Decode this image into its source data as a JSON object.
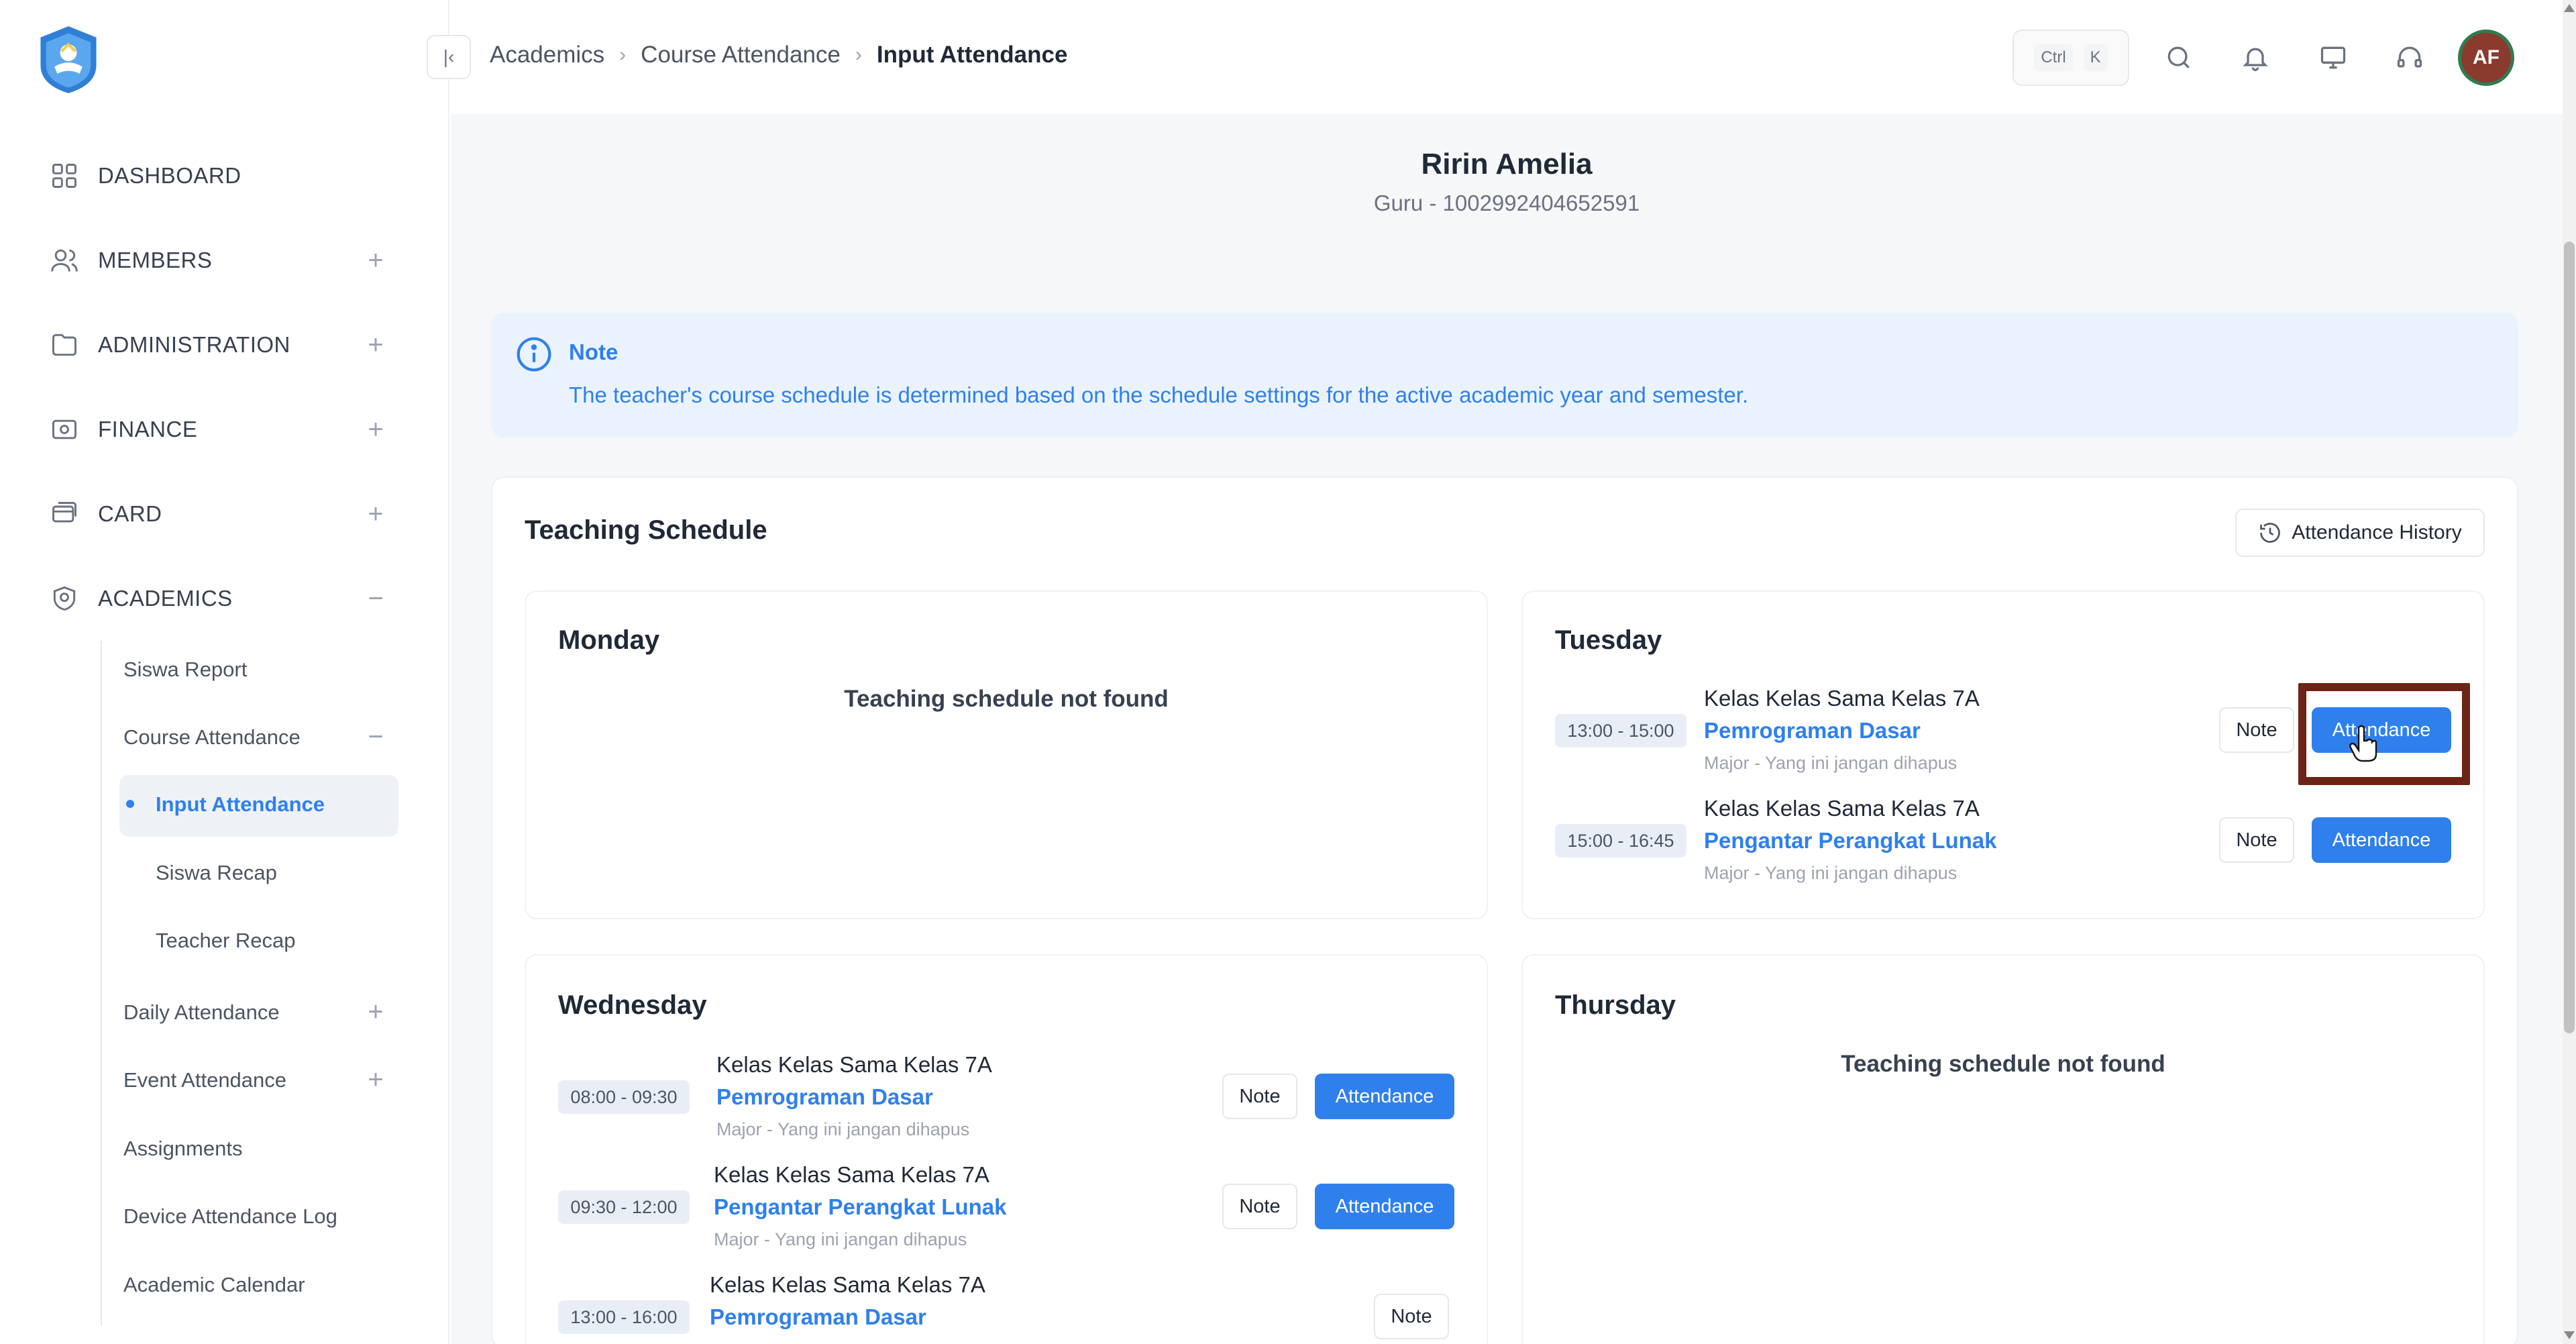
{
  "sidebar": {
    "nav": [
      {
        "label": "DASHBOARD",
        "icon": "grid-icon",
        "expandable": false
      },
      {
        "label": "MEMBERS",
        "icon": "users-icon",
        "expandable": true
      },
      {
        "label": "ADMINISTRATION",
        "icon": "folder-icon",
        "expandable": true
      },
      {
        "label": "FINANCE",
        "icon": "wallet-icon",
        "expandable": true
      },
      {
        "label": "CARD",
        "icon": "card-icon",
        "expandable": true
      },
      {
        "label": "ACADEMICS",
        "icon": "academics-icon",
        "expandable": true,
        "expanded": true
      }
    ],
    "academics": {
      "siswa_report": "Siswa Report",
      "course_attendance": "Course Attendance",
      "input_attendance": "Input Attendance",
      "siswa_recap": "Siswa Recap",
      "teacher_recap": "Teacher Recap",
      "daily_attendance": "Daily Attendance",
      "event_attendance": "Event Attendance",
      "assignments": "Assignments",
      "device_attendance_log": "Device Attendance Log",
      "academic_calendar": "Academic Calendar"
    }
  },
  "header": {
    "collapse_icon": "collapse-left-icon",
    "breadcrumb": [
      "Academics",
      "Course Attendance",
      "Input Attendance"
    ],
    "shortcut": [
      "Ctrl",
      "K"
    ],
    "avatar_initials": "AF"
  },
  "profile": {
    "name": "Ririn Amelia",
    "subtitle": "Guru - 1002992404652591"
  },
  "note": {
    "title": "Note",
    "text": "The teacher's course schedule is determined based on the schedule settings for the active academic year and semester."
  },
  "schedule": {
    "title": "Teaching Schedule",
    "history_button": "Attendance History",
    "note_label": "Note",
    "attendance_label": "Attendance",
    "not_found": "Teaching schedule not found",
    "days": {
      "monday": {
        "name": "Monday"
      },
      "tuesday": {
        "name": "Tuesday",
        "sessions": [
          {
            "time": "13:00 - 15:00",
            "class": "Kelas Kelas Sama Kelas 7A",
            "course": "Pemrograman Dasar",
            "major": "Major - Yang ini jangan dihapus"
          },
          {
            "time": "15:00 - 16:45",
            "class": "Kelas Kelas Sama Kelas 7A",
            "course": "Pengantar Perangkat Lunak",
            "major": "Major - Yang ini jangan dihapus"
          }
        ]
      },
      "wednesday": {
        "name": "Wednesday",
        "sessions": [
          {
            "time": "08:00 - 09:30",
            "class": "Kelas Kelas Sama Kelas 7A",
            "course": "Pemrograman Dasar",
            "major": "Major - Yang ini jangan dihapus"
          },
          {
            "time": "09:30 - 12:00",
            "class": "Kelas Kelas Sama Kelas 7A",
            "course": "Pengantar Perangkat Lunak",
            "major": "Major - Yang ini jangan dihapus"
          },
          {
            "time": "13:00 - 16:00",
            "class": "Kelas Kelas Sama Kelas 7A",
            "course": "Pemrograman Dasar"
          }
        ]
      },
      "thursday": {
        "name": "Thursday"
      }
    }
  },
  "colors": {
    "accent": "#2f80ed",
    "highlight": "#6b2415",
    "avatar_bg": "#8b3a2e",
    "avatar_ring": "#2e7d4f"
  }
}
